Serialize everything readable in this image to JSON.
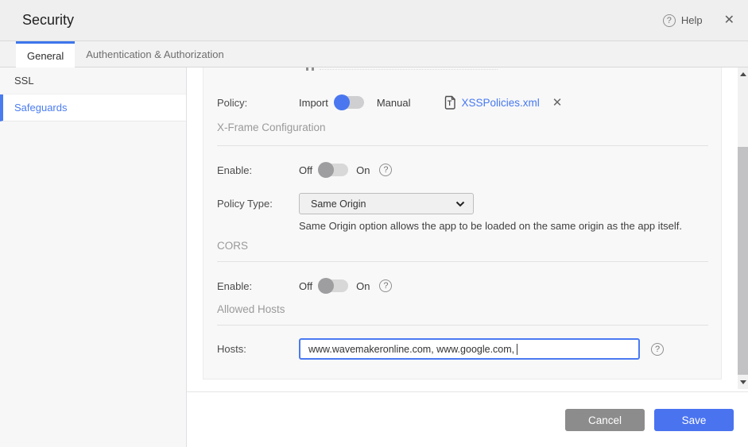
{
  "header": {
    "title": "Security",
    "help_label": "Help",
    "close_glyph": "✕",
    "help_glyph": "?"
  },
  "tabs": [
    {
      "label": "General",
      "active": true
    },
    {
      "label": "Authentication & Authorization",
      "active": false
    }
  ],
  "sidebar": {
    "items": [
      {
        "label": "SSL",
        "active": false
      },
      {
        "label": "Safeguards",
        "active": true
      }
    ]
  },
  "content": {
    "policy": {
      "label": "Policy:",
      "option_left": "Import",
      "option_right": "Manual",
      "toggle_state": "import",
      "file_name": "XSSPolicies.xml",
      "remove_glyph": "✕"
    },
    "xframe": {
      "heading": "X-Frame Configuration",
      "enable_label": "Enable:",
      "off_label": "Off",
      "on_label": "On",
      "enable_state": "off",
      "policy_type_label": "Policy Type:",
      "policy_type_value": "Same Origin",
      "description": "Same Origin option allows the app to be loaded on the same origin as the app itself."
    },
    "cors": {
      "heading": "CORS",
      "enable_label": "Enable:",
      "off_label": "Off",
      "on_label": "On",
      "enable_state": "off"
    },
    "allowed_hosts": {
      "heading": "Allowed Hosts",
      "hosts_label": "Hosts:",
      "hosts_value": "www.wavemakeronline.com, www.google.com, "
    }
  },
  "footer": {
    "cancel_label": "Cancel",
    "save_label": "Save"
  },
  "colors": {
    "accent_blue": "#4a77f0",
    "link_blue": "#4678f0",
    "save_blue": "#4a73f0",
    "cancel_gray": "#8c8c8c",
    "tab_active_border": "#3c76ec"
  }
}
